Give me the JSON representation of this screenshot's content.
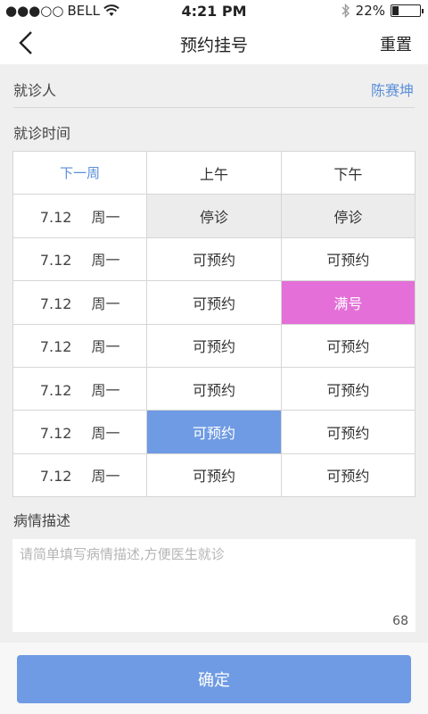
{
  "status_bar": {
    "signal": "●●●○○",
    "carrier": "BELL",
    "time": "4:21 PM",
    "battery": "22%",
    "battery_level": 0.22
  },
  "nav": {
    "title": "预约挂号",
    "reset_label": "重置"
  },
  "patient": {
    "label": "就诊人",
    "name": "陈赛坤"
  },
  "schedule": {
    "label": "就诊时间",
    "next_week": "下一周",
    "columns": [
      "上午",
      "下午"
    ],
    "rows": [
      {
        "date": "7.12",
        "day": "周一",
        "am": "停诊",
        "pm": "停诊"
      },
      {
        "date": "7.12",
        "day": "周一",
        "am": "可预约",
        "pm": "可预约"
      },
      {
        "date": "7.12",
        "day": "周一",
        "am": "可预约",
        "pm": "满号"
      },
      {
        "date": "7.12",
        "day": "周一",
        "am": "可预约",
        "pm": "可预约"
      },
      {
        "date": "7.12",
        "day": "周一",
        "am": "可预约",
        "pm": "可预约"
      },
      {
        "date": "7.12",
        "day": "周一",
        "am": "可预约",
        "pm": "可预约"
      },
      {
        "date": "7.12",
        "day": "周一",
        "am": "可预约",
        "pm": "可预约"
      }
    ]
  },
  "description": {
    "label": "病情描述",
    "placeholder": "请简单填写病情描述,方便医生就诊",
    "value": "",
    "count": "68"
  },
  "confirm_label": "确定",
  "colors": {
    "accent": "#6e9be3",
    "link": "#5b8fd9",
    "full": "#e46fd8"
  }
}
